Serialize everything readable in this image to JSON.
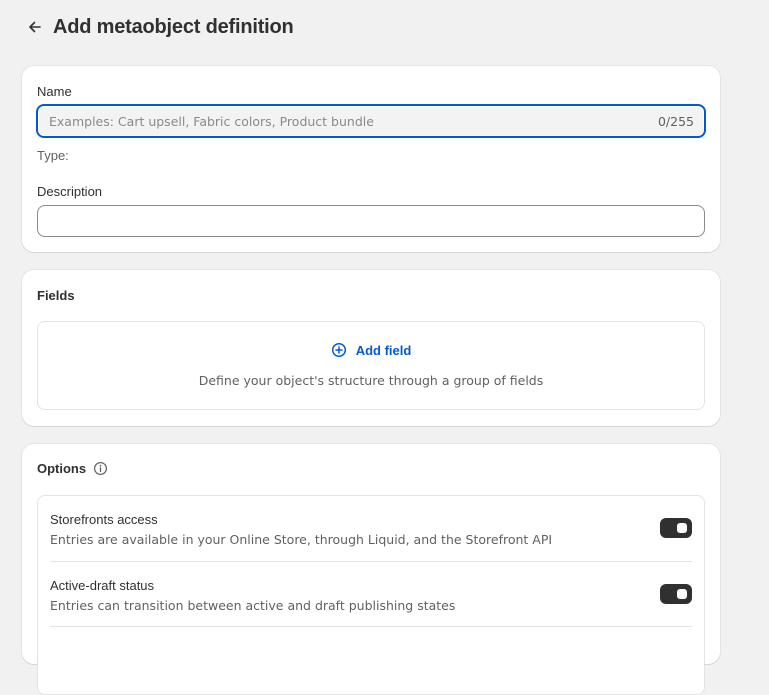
{
  "header": {
    "back_icon": "arrow-left-icon",
    "title": "Add metaobject definition"
  },
  "name_card": {
    "name_label": "Name",
    "name_placeholder": "Examples: Cart upsell, Fabric colors, Product bundle",
    "name_value": "",
    "counter": "0/255",
    "type_label": "Type:",
    "description_label": "Description",
    "description_value": ""
  },
  "fields_card": {
    "title": "Fields",
    "add_field_icon": "plus-circle-icon",
    "add_field_label": "Add field",
    "help_text": "Define your object's structure through a group of fields"
  },
  "options_card": {
    "title": "Options",
    "info_icon": "info-icon",
    "options": [
      {
        "title": "Storefronts access",
        "description": "Entries are available in your Online Store, through Liquid, and the Storefront API",
        "enabled": true
      },
      {
        "title": "Active-draft status",
        "description": "Entries can transition between active and draft publishing states",
        "enabled": true
      }
    ]
  },
  "colors": {
    "accent": "#005bd3",
    "toggle_on": "#303030",
    "background": "#f1f1f1"
  }
}
